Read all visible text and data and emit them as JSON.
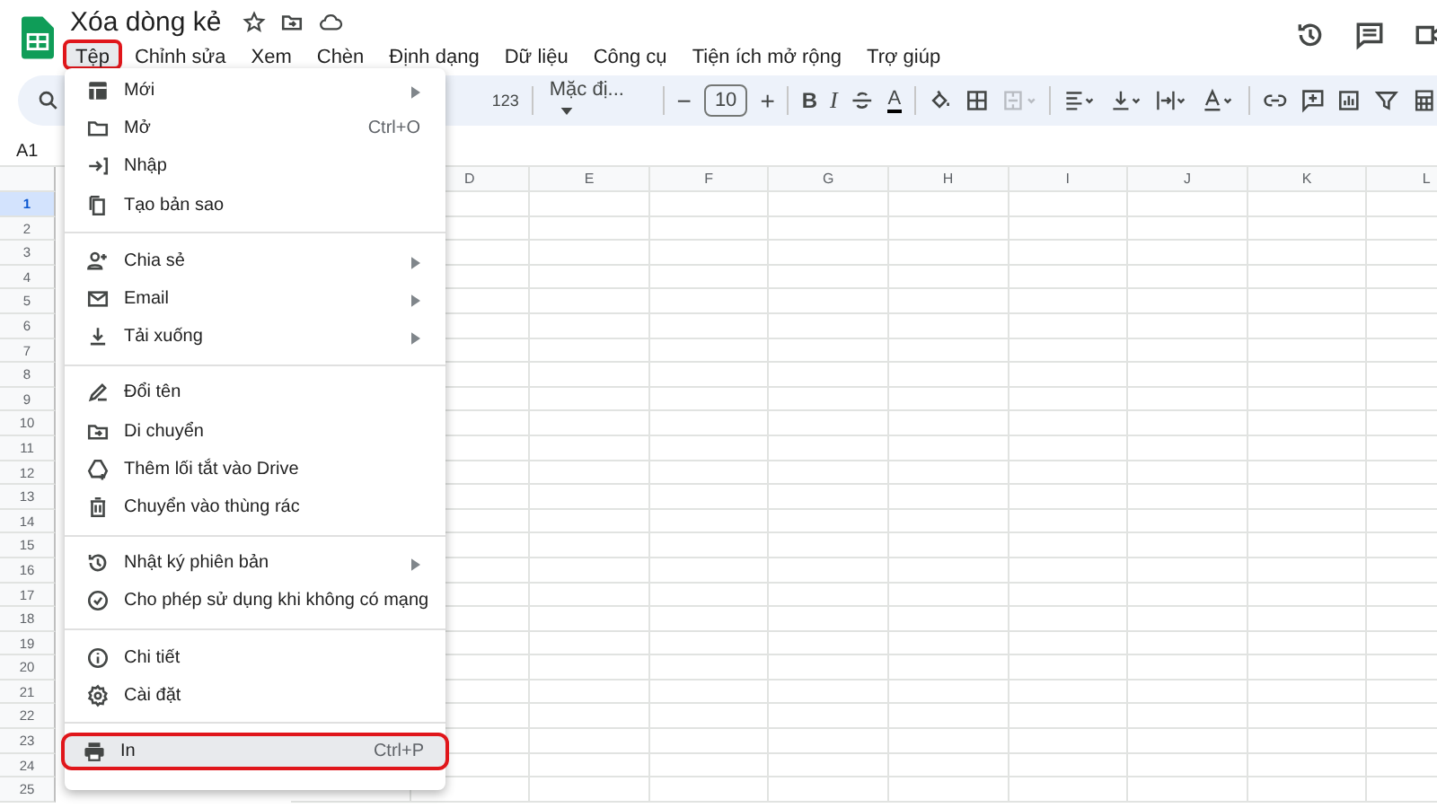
{
  "document": {
    "title": "Xóa dòng kẻ"
  },
  "menubar": [
    {
      "label": "Tệp",
      "selected": true
    },
    {
      "label": "Chỉnh sửa",
      "selected": false
    },
    {
      "label": "Xem",
      "selected": false
    },
    {
      "label": "Chèn",
      "selected": false
    },
    {
      "label": "Định dạng",
      "selected": false
    },
    {
      "label": "Dữ liệu",
      "selected": false
    },
    {
      "label": "Công cụ",
      "selected": false
    },
    {
      "label": "Tiện ích mở rộng",
      "selected": false
    },
    {
      "label": "Trợ giúp",
      "selected": false
    }
  ],
  "toolbar": {
    "number_format": "123",
    "font": "Mặc đị...",
    "minus": "−",
    "font_size": "10",
    "plus": "+",
    "bold": "B",
    "italic": "I",
    "text_color": "A"
  },
  "name_box": "A1",
  "columns": [
    "D",
    "E",
    "F",
    "G",
    "H",
    "I",
    "J",
    "K",
    "L"
  ],
  "row_numbers": [
    {
      "label": "1",
      "selected": true
    },
    {
      "label": "2",
      "selected": false
    },
    {
      "label": "3",
      "selected": false
    },
    {
      "label": "4",
      "selected": false
    },
    {
      "label": "5",
      "selected": false
    },
    {
      "label": "6",
      "selected": false
    },
    {
      "label": "7",
      "selected": false
    },
    {
      "label": "8",
      "selected": false
    },
    {
      "label": "9",
      "selected": false
    },
    {
      "label": "10",
      "selected": false
    },
    {
      "label": "11",
      "selected": false
    },
    {
      "label": "12",
      "selected": false
    },
    {
      "label": "13",
      "selected": false
    },
    {
      "label": "14",
      "selected": false
    },
    {
      "label": "15",
      "selected": false
    },
    {
      "label": "16",
      "selected": false
    },
    {
      "label": "17",
      "selected": false
    },
    {
      "label": "18",
      "selected": false
    },
    {
      "label": "19",
      "selected": false
    },
    {
      "label": "20",
      "selected": false
    },
    {
      "label": "21",
      "selected": false
    },
    {
      "label": "22",
      "selected": false
    },
    {
      "label": "23",
      "selected": false
    },
    {
      "label": "24",
      "selected": false
    },
    {
      "label": "25",
      "selected": false
    }
  ],
  "file_menu": {
    "groups": [
      [
        {
          "label": "Mới",
          "submenu": true,
          "highlighted": false
        },
        {
          "label": "Mở",
          "shortcut": "Ctrl+O",
          "submenu": false,
          "highlighted": false
        },
        {
          "label": "Nhập",
          "submenu": false,
          "highlighted": false
        },
        {
          "label": "Tạo bản sao",
          "submenu": false,
          "highlighted": false
        }
      ],
      [
        {
          "label": "Chia sẻ",
          "submenu": true,
          "highlighted": false
        },
        {
          "label": "Email",
          "submenu": true,
          "highlighted": false
        },
        {
          "label": "Tải xuống",
          "submenu": true,
          "highlighted": false
        }
      ],
      [
        {
          "label": "Đổi tên",
          "submenu": false,
          "highlighted": false
        },
        {
          "label": "Di chuyển",
          "submenu": false,
          "highlighted": false
        },
        {
          "label": "Thêm lối tắt vào Drive",
          "submenu": false,
          "highlighted": false
        },
        {
          "label": "Chuyển vào thùng rác",
          "submenu": false,
          "highlighted": false
        }
      ],
      [
        {
          "label": "Nhật ký phiên bản",
          "submenu": true,
          "highlighted": false
        },
        {
          "label": "Cho phép sử dụng khi không có mạng",
          "submenu": false,
          "highlighted": false
        }
      ],
      [
        {
          "label": "Chi tiết",
          "submenu": false,
          "highlighted": false
        },
        {
          "label": "Cài đặt",
          "submenu": false,
          "highlighted": false
        }
      ],
      [
        {
          "label": "In",
          "shortcut": "Ctrl+P",
          "submenu": false,
          "highlighted": true
        }
      ]
    ]
  }
}
